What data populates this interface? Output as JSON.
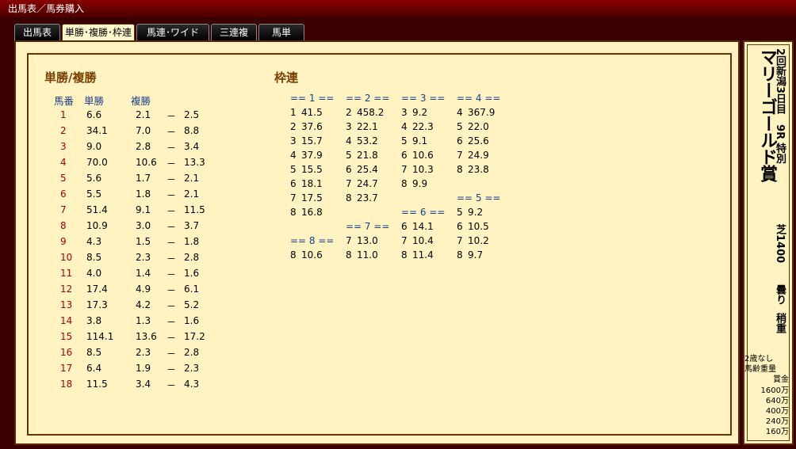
{
  "window": {
    "title": "出馬表／馬券購入"
  },
  "tabs": [
    {
      "label": "出馬表",
      "active": false
    },
    {
      "label": "単勝･複勝･枠連",
      "active": true
    },
    {
      "label": "馬連･ワイド",
      "active": false
    },
    {
      "label": "三連複",
      "active": false
    },
    {
      "label": "馬単",
      "active": false
    }
  ],
  "win_place": {
    "title": "単勝/複勝",
    "headers": {
      "no": "馬番",
      "win": "単勝",
      "place": "複勝"
    },
    "dash": "－",
    "rows": [
      {
        "no": "1",
        "win": "6.6",
        "pmin": "2.1",
        "pmax": "2.5"
      },
      {
        "no": "2",
        "win": "34.1",
        "pmin": "7.0",
        "pmax": "8.8"
      },
      {
        "no": "3",
        "win": "9.0",
        "pmin": "2.8",
        "pmax": "3.4"
      },
      {
        "no": "4",
        "win": "70.0",
        "pmin": "10.6",
        "pmax": "13.3"
      },
      {
        "no": "5",
        "win": "5.6",
        "pmin": "1.7",
        "pmax": "2.1"
      },
      {
        "no": "6",
        "win": "5.5",
        "pmin": "1.8",
        "pmax": "2.1"
      },
      {
        "no": "7",
        "win": "51.4",
        "pmin": "9.1",
        "pmax": "11.5"
      },
      {
        "no": "8",
        "win": "10.9",
        "pmin": "3.0",
        "pmax": "3.7"
      },
      {
        "no": "9",
        "win": "4.3",
        "pmin": "1.5",
        "pmax": "1.8"
      },
      {
        "no": "10",
        "win": "8.5",
        "pmin": "2.3",
        "pmax": "2.8"
      },
      {
        "no": "11",
        "win": "4.0",
        "pmin": "1.4",
        "pmax": "1.6"
      },
      {
        "no": "12",
        "win": "17.4",
        "pmin": "4.9",
        "pmax": "6.1"
      },
      {
        "no": "13",
        "win": "17.3",
        "pmin": "4.2",
        "pmax": "5.2"
      },
      {
        "no": "14",
        "win": "3.8",
        "pmin": "1.3",
        "pmax": "1.6"
      },
      {
        "no": "15",
        "win": "114.1",
        "pmin": "13.6",
        "pmax": "17.2"
      },
      {
        "no": "16",
        "win": "8.5",
        "pmin": "2.3",
        "pmax": "2.8"
      },
      {
        "no": "17",
        "win": "6.4",
        "pmin": "1.9",
        "pmax": "2.3"
      },
      {
        "no": "18",
        "win": "11.5",
        "pmin": "3.4",
        "pmax": "4.3"
      }
    ]
  },
  "bracket": {
    "title": "枠連",
    "groups": [
      {
        "header": "== 1 ==",
        "items": [
          [
            "1",
            "41.5"
          ],
          [
            "2",
            "37.6"
          ],
          [
            "3",
            "15.7"
          ],
          [
            "4",
            "37.9"
          ],
          [
            "5",
            "15.5"
          ],
          [
            "6",
            "18.1"
          ],
          [
            "7",
            "17.5"
          ],
          [
            "8",
            "16.8"
          ]
        ]
      },
      {
        "header": "== 2 ==",
        "items": [
          [
            "2",
            "458.2"
          ],
          [
            "3",
            "22.1"
          ],
          [
            "4",
            "53.2"
          ],
          [
            "5",
            "21.8"
          ],
          [
            "6",
            "25.4"
          ],
          [
            "7",
            "24.7"
          ],
          [
            "8",
            "23.7"
          ]
        ]
      },
      {
        "header": "== 3 ==",
        "items": [
          [
            "3",
            "9.2"
          ],
          [
            "4",
            "22.3"
          ],
          [
            "5",
            "9.1"
          ],
          [
            "6",
            "10.6"
          ],
          [
            "7",
            "10.3"
          ],
          [
            "8",
            "9.9"
          ]
        ]
      },
      {
        "header": "== 4 ==",
        "items": [
          [
            "4",
            "367.9"
          ],
          [
            "5",
            "22.0"
          ],
          [
            "6",
            "25.6"
          ],
          [
            "7",
            "24.9"
          ],
          [
            "8",
            "23.8"
          ]
        ]
      },
      {
        "header": "== 5 ==",
        "items": [
          [
            "5",
            "9.2"
          ],
          [
            "6",
            "10.5"
          ],
          [
            "7",
            "10.2"
          ],
          [
            "8",
            "9.7"
          ]
        ]
      },
      {
        "header": "== 6 ==",
        "items": [
          [
            "6",
            "14.1"
          ],
          [
            "7",
            "10.4"
          ],
          [
            "8",
            "11.4"
          ]
        ]
      },
      {
        "header": "== 7 ==",
        "items": [
          [
            "7",
            "13.0"
          ],
          [
            "8",
            "11.0"
          ]
        ]
      },
      {
        "header": "== 8 ==",
        "items": [
          [
            "8",
            "10.6"
          ]
        ]
      }
    ]
  },
  "race": {
    "race_name": "マリーゴールド賞",
    "meeting": "2回新潟3日目　9R 特別",
    "course": "芝1400",
    "weather": "曇り",
    "going": "稍重",
    "conditions": [
      "2歳なし",
      "馬齢重量"
    ],
    "prize_label": "賞金",
    "prizes": [
      "1600万",
      "640万",
      "400万",
      "240万",
      "160万"
    ]
  }
}
